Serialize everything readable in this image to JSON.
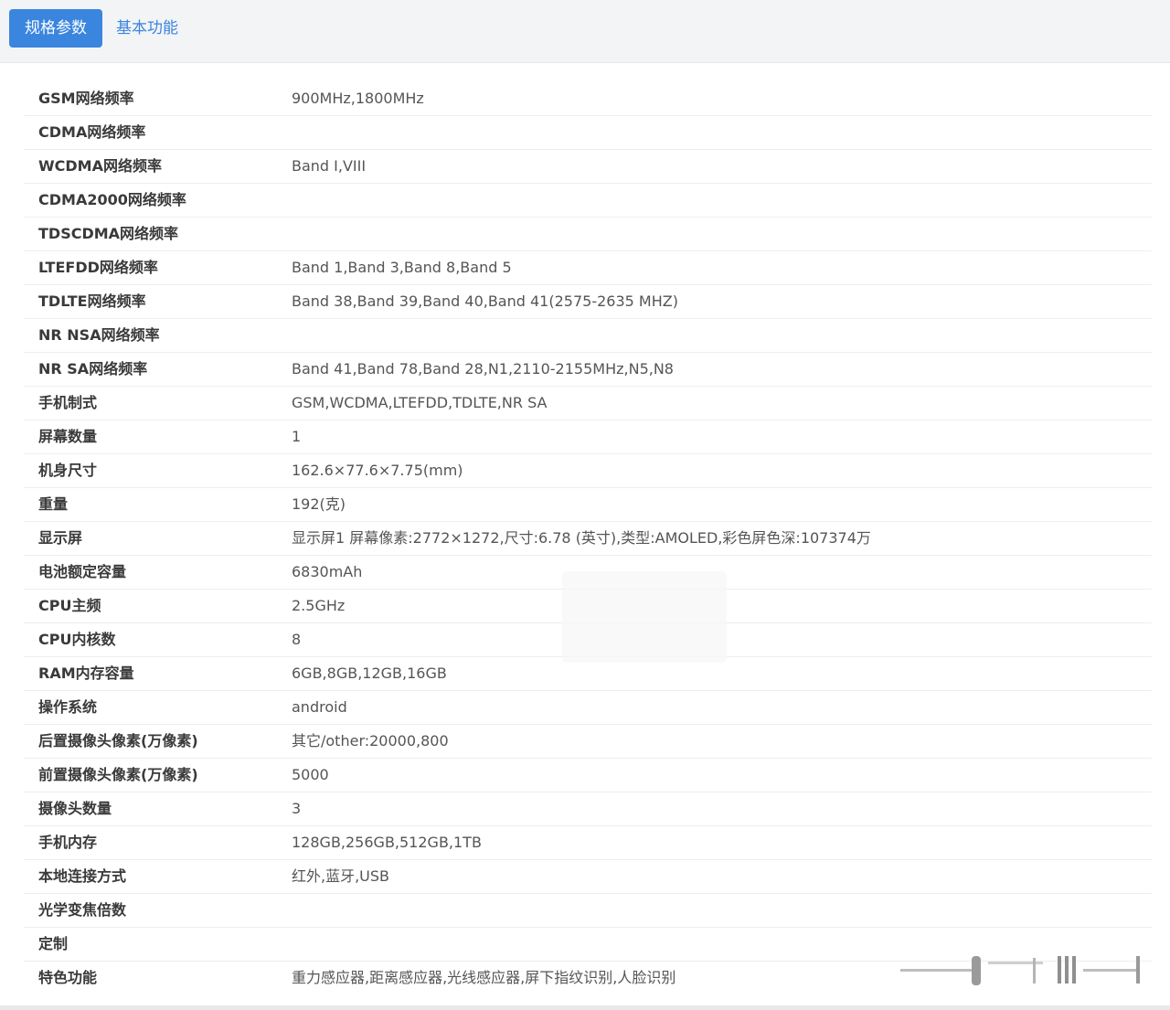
{
  "tabs": [
    {
      "label": "规格参数",
      "active": true
    },
    {
      "label": "基本功能",
      "active": false
    }
  ],
  "colors": {
    "accent": "#3a85de",
    "tabbar_bg": "#f3f4f6"
  },
  "specs": [
    {
      "key": "GSM网络频率",
      "value": "900MHz,1800MHz"
    },
    {
      "key": "CDMA网络频率",
      "value": ""
    },
    {
      "key": "WCDMA网络频率",
      "value": "Band I,VIII"
    },
    {
      "key": "CDMA2000网络频率",
      "value": ""
    },
    {
      "key": "TDSCDMA网络频率",
      "value": ""
    },
    {
      "key": "LTEFDD网络频率",
      "value": "Band 1,Band 3,Band 8,Band 5"
    },
    {
      "key": "TDLTE网络频率",
      "value": "Band 38,Band 39,Band 40,Band 41(2575-2635 MHZ)"
    },
    {
      "key": "NR NSA网络频率",
      "value": ""
    },
    {
      "key": "NR SA网络频率",
      "value": "Band 41,Band 78,Band 28,N1,2110-2155MHz,N5,N8"
    },
    {
      "key": "手机制式",
      "value": "GSM,WCDMA,LTEFDD,TDLTE,NR SA"
    },
    {
      "key": "屏幕数量",
      "value": "1"
    },
    {
      "key": "机身尺寸",
      "value": "162.6×77.6×7.75(mm)"
    },
    {
      "key": "重量",
      "value": "192(克)"
    },
    {
      "key": "显示屏",
      "value": "显示屏1 屏幕像素:2772×1272,尺寸:6.78 (英寸),类型:AMOLED,彩色屏色深:107374万"
    },
    {
      "key": "电池额定容量",
      "value": "6830mAh"
    },
    {
      "key": "CPU主频",
      "value": "2.5GHz"
    },
    {
      "key": "CPU内核数",
      "value": "8"
    },
    {
      "key": "RAM内存容量",
      "value": "6GB,8GB,12GB,16GB"
    },
    {
      "key": "操作系统",
      "value": "android"
    },
    {
      "key": "后置摄像头像素(万像素)",
      "value": "其它/other:20000,800"
    },
    {
      "key": "前置摄像头像素(万像素)",
      "value": "5000"
    },
    {
      "key": "摄像头数量",
      "value": "3"
    },
    {
      "key": "手机内存",
      "value": "128GB,256GB,512GB,1TB"
    },
    {
      "key": "本地连接方式",
      "value": "红外,蓝牙,USB"
    },
    {
      "key": "光学变焦倍数",
      "value": ""
    },
    {
      "key": "定制",
      "value": ""
    },
    {
      "key": "特色功能",
      "value": "重力感应器,距离感应器,光线感应器,屏下指纹识别,人脸识别"
    }
  ]
}
